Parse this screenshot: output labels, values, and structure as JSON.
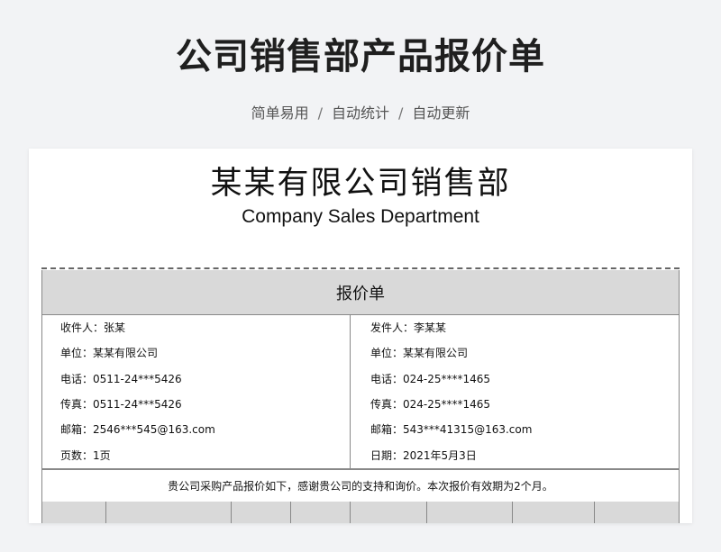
{
  "header": {
    "title": "公司销售部产品报价单",
    "tags": [
      "简单易用",
      "自动统计",
      "自动更新"
    ],
    "separator": "/"
  },
  "sheet": {
    "company_cn": "某某有限公司销售部",
    "company_en": "Company Sales Department",
    "quote_title": "报价单",
    "receiver": {
      "name": "收件人：张某",
      "company": "单位：某某有限公司",
      "phone": "电话：0511-24***5426",
      "fax": "传真：0511-24***5426",
      "email": "邮箱：2546***545@163.com",
      "pages": "页数：1页"
    },
    "sender": {
      "name": "发件人：李某某",
      "company": "单位：某某有限公司",
      "phone": "电话：024-25****1465",
      "fax": "传真：024-25****1465",
      "email": "邮箱：543***41315@163.com",
      "date": "日期：2021年5月3日"
    },
    "note": "贵公司采购产品报价如下，感谢贵公司的支持和询价。本次报价有效期为2个月。"
  }
}
